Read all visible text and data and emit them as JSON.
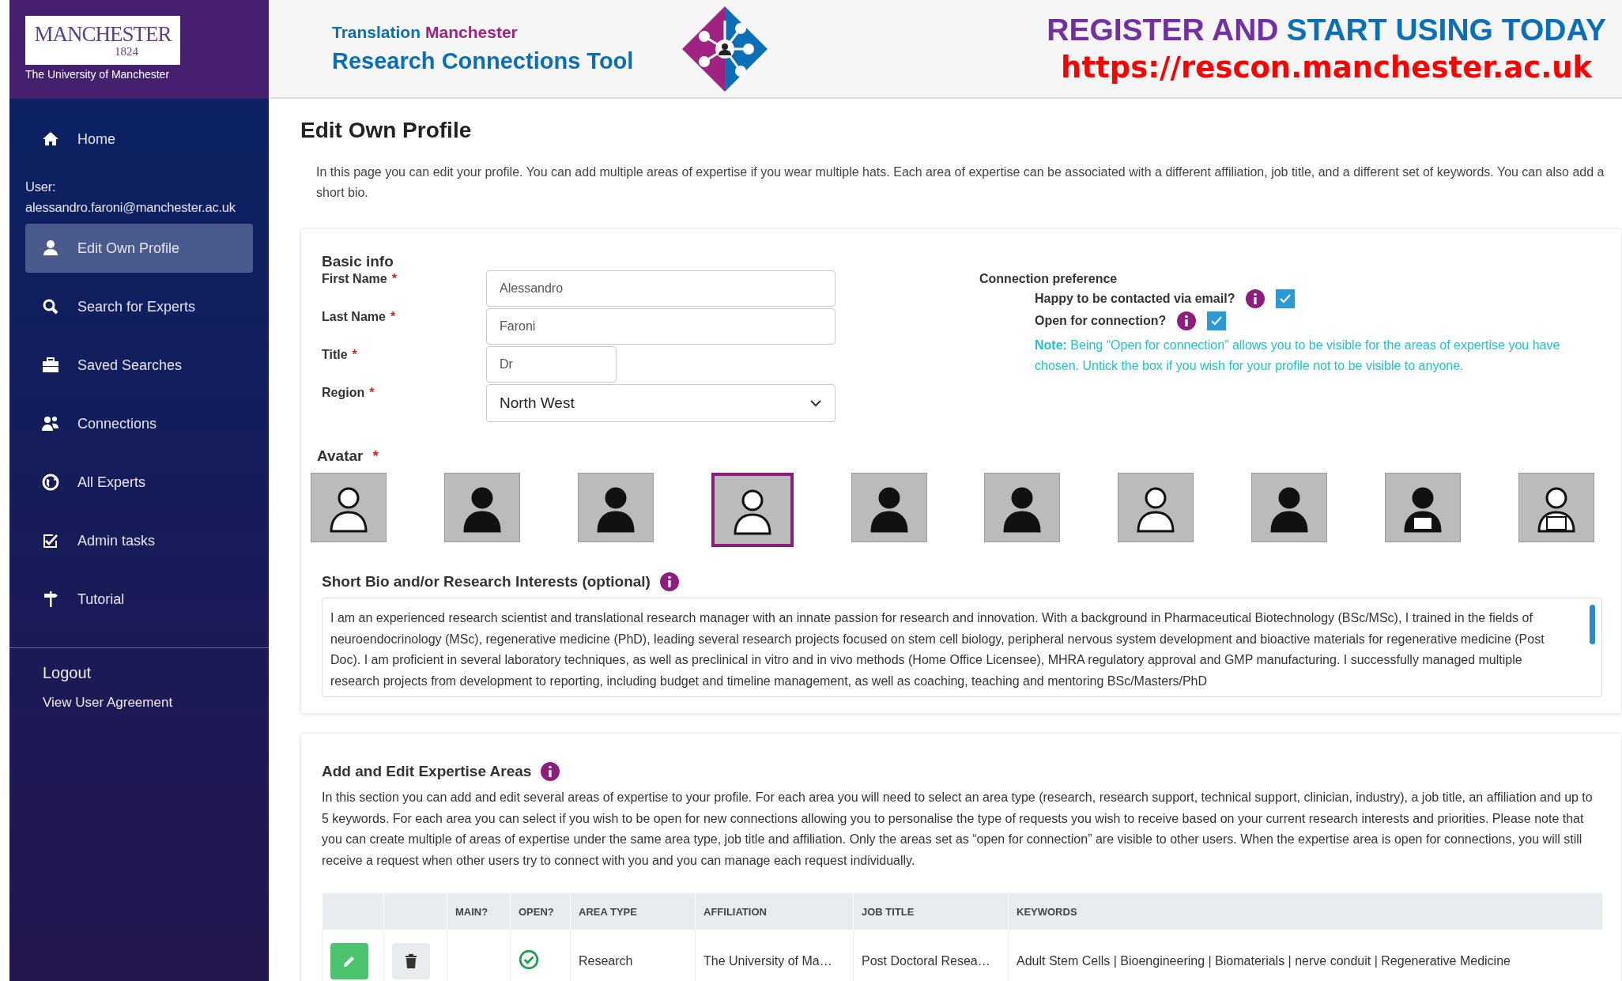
{
  "logo": {
    "wordmark": "MANCHESTER",
    "year": "1824",
    "subtitle": "The University of Manchester"
  },
  "brand": {
    "prefix": "Translation",
    "suffix": "Manchester",
    "title": "Research Connections Tool"
  },
  "banner": {
    "lead": "REGISTER AND",
    "tail": "START USING TODAY",
    "url": "https://rescon.manchester.ac.uk"
  },
  "sidebar": {
    "home": "Home",
    "user_label": "User:",
    "user_email": "alessandro.faroni@manchester.ac.uk",
    "items": [
      {
        "label": "Edit Own Profile",
        "selected": true
      },
      {
        "label": "Search for Experts",
        "selected": false
      },
      {
        "label": "Saved Searches",
        "selected": false
      },
      {
        "label": "Connections",
        "selected": false
      },
      {
        "label": "All Experts",
        "selected": false
      },
      {
        "label": "Admin tasks",
        "selected": false
      },
      {
        "label": "Tutorial",
        "selected": false
      }
    ],
    "logout": "Logout",
    "agreement": "View User Agreement"
  },
  "page": {
    "title": "Edit Own Profile",
    "intro": "In this page you can edit your profile. You can add multiple areas of expertise if you wear multiple hats. Each area of expertise can be associated with a different affiliation, job title, and a different set of keywords. You can also add a short bio."
  },
  "basic_info": {
    "heading": "Basic info",
    "required_mark": "*",
    "fields": [
      {
        "label": "First Name",
        "value": "Alessandro",
        "kind": "text"
      },
      {
        "label": "Last Name",
        "value": "Faroni",
        "kind": "text"
      },
      {
        "label": "Title",
        "value": "Dr",
        "kind": "short"
      },
      {
        "label": "Region",
        "value": "North West",
        "kind": "select"
      }
    ]
  },
  "connection": {
    "heading": "Connection preference",
    "options": [
      {
        "label": "Happy to be contacted via email?",
        "checked": true
      },
      {
        "label": "Open for connection?",
        "checked": true
      }
    ],
    "note": "**Note:** Being “Open for connection” allows you to be visible for the areas of expertise you have chosen. Untick the box if you wish for your profile not to be visible to anyone."
  },
  "avatar": {
    "label": "Avatar",
    "required_mark": "*",
    "options": [
      {
        "selected": false
      },
      {
        "selected": false
      },
      {
        "selected": false
      },
      {
        "selected": true
      },
      {
        "selected": false
      },
      {
        "selected": false
      },
      {
        "selected": false
      },
      {
        "selected": false
      },
      {
        "selected": false
      },
      {
        "selected": false
      }
    ]
  },
  "bio": {
    "label": "Short Bio and/or Research Interests (optional)",
    "value": "I am an experienced research scientist and translational research manager with an innate passion for research and innovation. With a background in Pharmaceutical Biotechnology (BSc/MSc), I trained in the fields of neuroendocrinology (MSc), regenerative medicine (PhD), leading several research projects focused on stem cell biology, peripheral nervous system development and bioactive materials for regenerative medicine (Post Doc). I am proficient in several laboratory techniques, as well as preclinical in vitro and in vivo methods (Home Office Licensee), MHRA regulatory approval and GMP manufacturing. I successfully managed multiple research projects from development to reporting, including budget and timeline management, as well as coaching, teaching and mentoring BSc/Masters/PhD"
  },
  "expertise": {
    "heading": "Add and Edit Expertise Areas",
    "description": "In this section you can add and edit several areas of expertise to your profile. For each area you will need to select an area type (research, research support, technical support, clinician, industry), a job title, an affiliation and up to 5 keywords. For each area you can select if you wish to be open for new connections allowing you to personalise the type of requests you wish to receive based on your current research interests and priorities. Please note that you can create multiple of areas of expertise under the same area type, job title and affiliation. Only the areas set as “open for connection” are visible to other users. When the expertise area is open for connections, you will still receive a request when other users try to connect with you and you can manage each request individually.",
    "table": {
      "columns": [
        "MAIN?",
        "OPEN?",
        "AREA TYPE",
        "AFFILIATION",
        "JOB TITLE",
        "KEYWORDS"
      ],
      "rows": [
        {
          "main": false,
          "open": true,
          "area_type": "Research",
          "affiliation": "The University of Ma…",
          "job_title": "Post Doctoral Resea…",
          "keywords": "Adult Stem Cells | Bioengineering | Biomaterials | nerve conduit | Regenerative Medicine"
        }
      ]
    }
  }
}
